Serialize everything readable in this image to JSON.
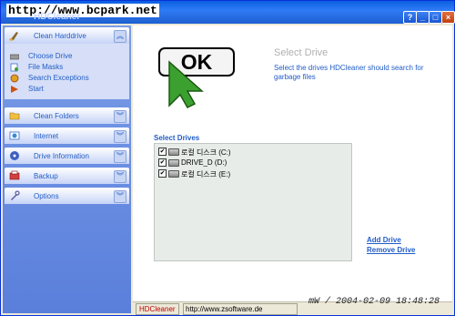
{
  "watermark": "http://www.bcpark.net",
  "window": {
    "title": "HDCleaner",
    "buttons": [
      "?",
      "_",
      "□",
      "×"
    ]
  },
  "sidebar": {
    "sections": [
      {
        "label": "Clean Harddrive",
        "expanded": true,
        "icon": "broom-icon"
      },
      {
        "label": "Clean Folders",
        "expanded": false,
        "icon": "folder-icon"
      },
      {
        "label": "Internet",
        "expanded": false,
        "icon": "internet-icon"
      },
      {
        "label": "Drive Information",
        "expanded": false,
        "icon": "drive-icon"
      },
      {
        "label": "Backup",
        "expanded": false,
        "icon": "backup-icon"
      },
      {
        "label": "Options",
        "expanded": false,
        "icon": "options-icon"
      }
    ],
    "tasks": [
      {
        "label": "Choose Drive",
        "icon": "drive-icon"
      },
      {
        "label": "File Masks",
        "icon": "mask-icon"
      },
      {
        "label": "Search Exceptions",
        "icon": "exception-icon"
      },
      {
        "label": "Start",
        "icon": "start-icon"
      }
    ]
  },
  "main": {
    "ok_label": "OK",
    "title": "Select Drive",
    "description": "Select the drives HDCleaner should search for garbage files",
    "drives_title": "Select Drives",
    "drives": [
      {
        "label": "로컬 디스크 (C:)",
        "checked": true
      },
      {
        "label": "DRIVE_D (D:)",
        "checked": true
      },
      {
        "label": "로컬 디스크 (E:)",
        "checked": true
      }
    ],
    "add_drive": "Add Drive",
    "remove_drive": "Remove Drive"
  },
  "status": {
    "app": "HDCleaner",
    "url": "http://www.zsoftware.de"
  },
  "stamp": "mW / 2004-02-09 18:48:28",
  "colors": {
    "link": "#215dc6",
    "sidebar": "#6b8fe0",
    "titlebar": "#1e5fd0"
  }
}
